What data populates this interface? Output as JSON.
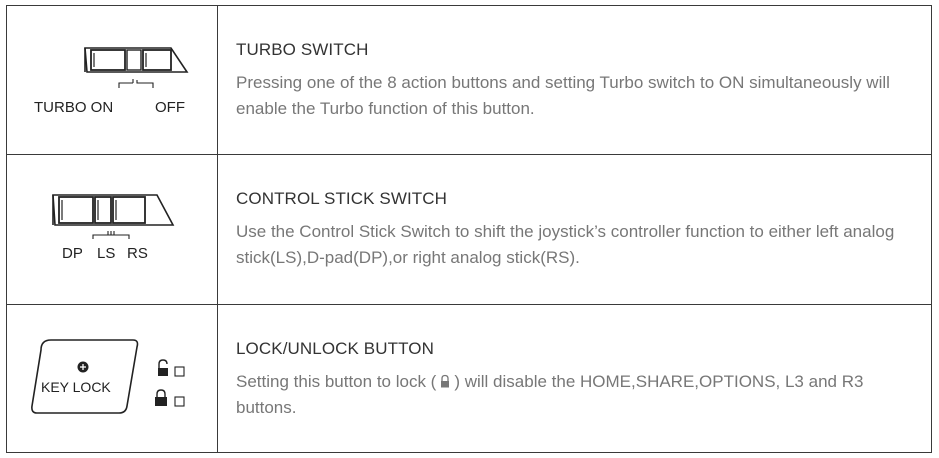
{
  "rows": [
    {
      "icon": "turbo-switch-icon",
      "icon_labels": [
        "TURBO ON",
        "OFF"
      ],
      "title": "TURBO SWITCH",
      "body": "Pressing one of the 8 action buttons and setting Turbo switch to ON simultaneously will enable the Turbo function of this button."
    },
    {
      "icon": "control-stick-switch-icon",
      "icon_labels": [
        "DP",
        "LS",
        "RS"
      ],
      "title": "CONTROL STICK SWITCH",
      "body": "Use the Control Stick Switch to shift the joystick’s controller function to either left analog stick(LS),D-pad(DP),or right analog stick(RS)."
    },
    {
      "icon": "key-lock-button-icon",
      "icon_labels": [
        "KEY LOCK"
      ],
      "title": "LOCK/UNLOCK BUTTON",
      "body_parts": [
        "Setting this button to lock (",
        ") will disable the HOME,SHARE,OPTIONS, L3 and R3 buttons."
      ],
      "body_icon": "lock-icon"
    }
  ]
}
